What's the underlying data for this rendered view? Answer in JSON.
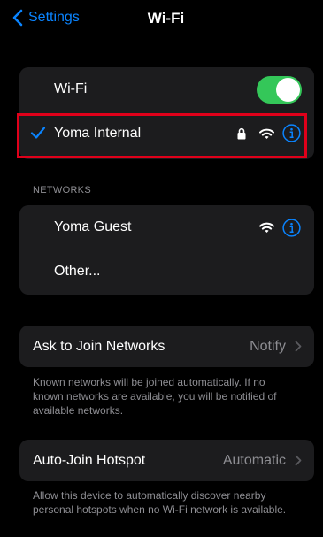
{
  "nav": {
    "back_label": "Settings",
    "title": "Wi-Fi"
  },
  "wifi_toggle": {
    "label": "Wi-Fi",
    "state": "on"
  },
  "current_network": {
    "name": "Yoma Internal",
    "connected": true,
    "secured": true
  },
  "networks_section": {
    "header": "NETWORKS",
    "items": [
      {
        "name": "Yoma Guest"
      },
      {
        "name": "Other..."
      }
    ]
  },
  "ask_to_join": {
    "label": "Ask to Join Networks",
    "value": "Notify",
    "footnote": "Known networks will be joined automatically. If no known networks are available, you will be notified of available networks."
  },
  "auto_join_hotspot": {
    "label": "Auto-Join Hotspot",
    "value": "Automatic",
    "footnote": "Allow this device to automatically discover nearby personal hotspots when no Wi-Fi network is available."
  },
  "colors": {
    "accent": "#0a84ff",
    "toggle_on": "#34c759",
    "background": "#000000",
    "group_bg": "#1c1c1e",
    "secondary_text": "#8e8e93",
    "highlight": "#e0001a"
  }
}
